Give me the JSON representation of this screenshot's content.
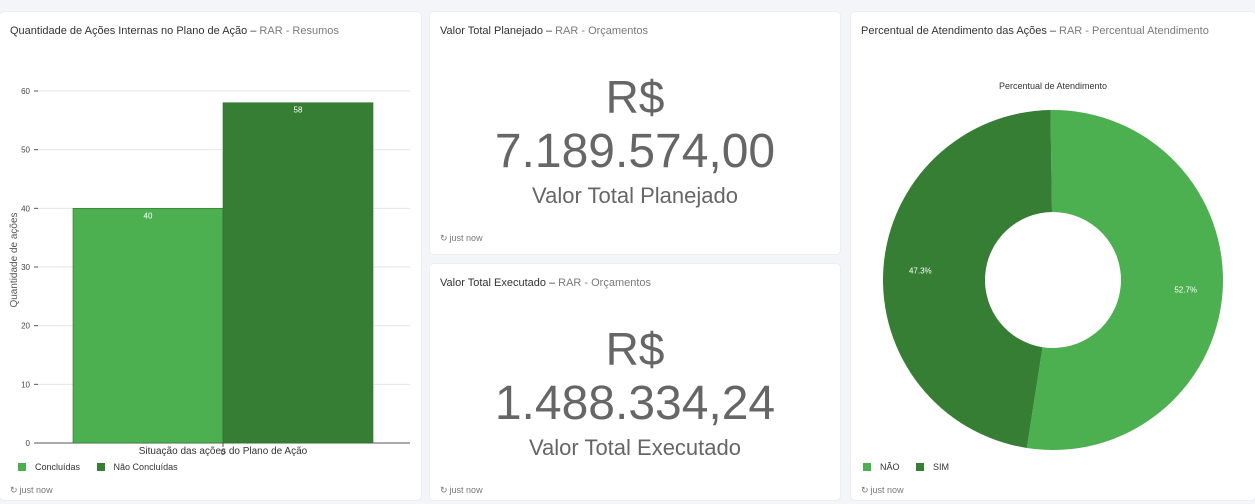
{
  "bar_card": {
    "title": "Quantidade de Ações Internas no Plano de Ação",
    "dash": "–",
    "source": "RAR - Resumos",
    "refresh": "just now",
    "ylabel": "Quantidade de ações",
    "xlabel": "Situação das ações do Plano de Ação"
  },
  "planned_card": {
    "title": "Valor Total Planejado",
    "dash": "–",
    "source": "RAR - Orçamentos",
    "currency": "R$",
    "value": "7.189.574,00",
    "subtitle": "Valor Total Planejado",
    "refresh": "just now"
  },
  "executed_card": {
    "title": "Valor Total Executado",
    "dash": "–",
    "source": "RAR - Orçamentos",
    "currency": "R$",
    "value": "1.488.334,24",
    "subtitle": "Valor Total Executado",
    "refresh": "just now"
  },
  "pie_card": {
    "title": "Percentual de Atendimento das Ações",
    "dash": "–",
    "source": "RAR - Percentual Atendimento",
    "refresh": "just now"
  },
  "colors": {
    "light_green": "#4caf50",
    "dark_green": "#357e33"
  },
  "chart_data": [
    {
      "type": "bar",
      "categories": [
        "0"
      ],
      "series": [
        {
          "name": "Concluídas",
          "values": [
            40
          ],
          "color": "#4caf50"
        },
        {
          "name": "Não Concluídas",
          "values": [
            58
          ],
          "color": "#357e33"
        }
      ],
      "xlabel": "Situação das ações do Plano de Ação",
      "ylabel": "Quantidade de ações",
      "ylim": [
        0,
        60
      ],
      "yticks": [
        0,
        10,
        20,
        30,
        40,
        50,
        60
      ],
      "data_labels": true,
      "grid": true,
      "legend": "bottom-left"
    },
    {
      "type": "pie",
      "title": "Percentual de Atendimento",
      "donut": true,
      "slices": [
        {
          "label": "NÃO",
          "value": 52.7,
          "display": "52.7%",
          "color": "#4caf50"
        },
        {
          "label": "SIM",
          "value": 47.3,
          "display": "47.3%",
          "color": "#357e33"
        }
      ],
      "legend": "bottom-left"
    }
  ]
}
